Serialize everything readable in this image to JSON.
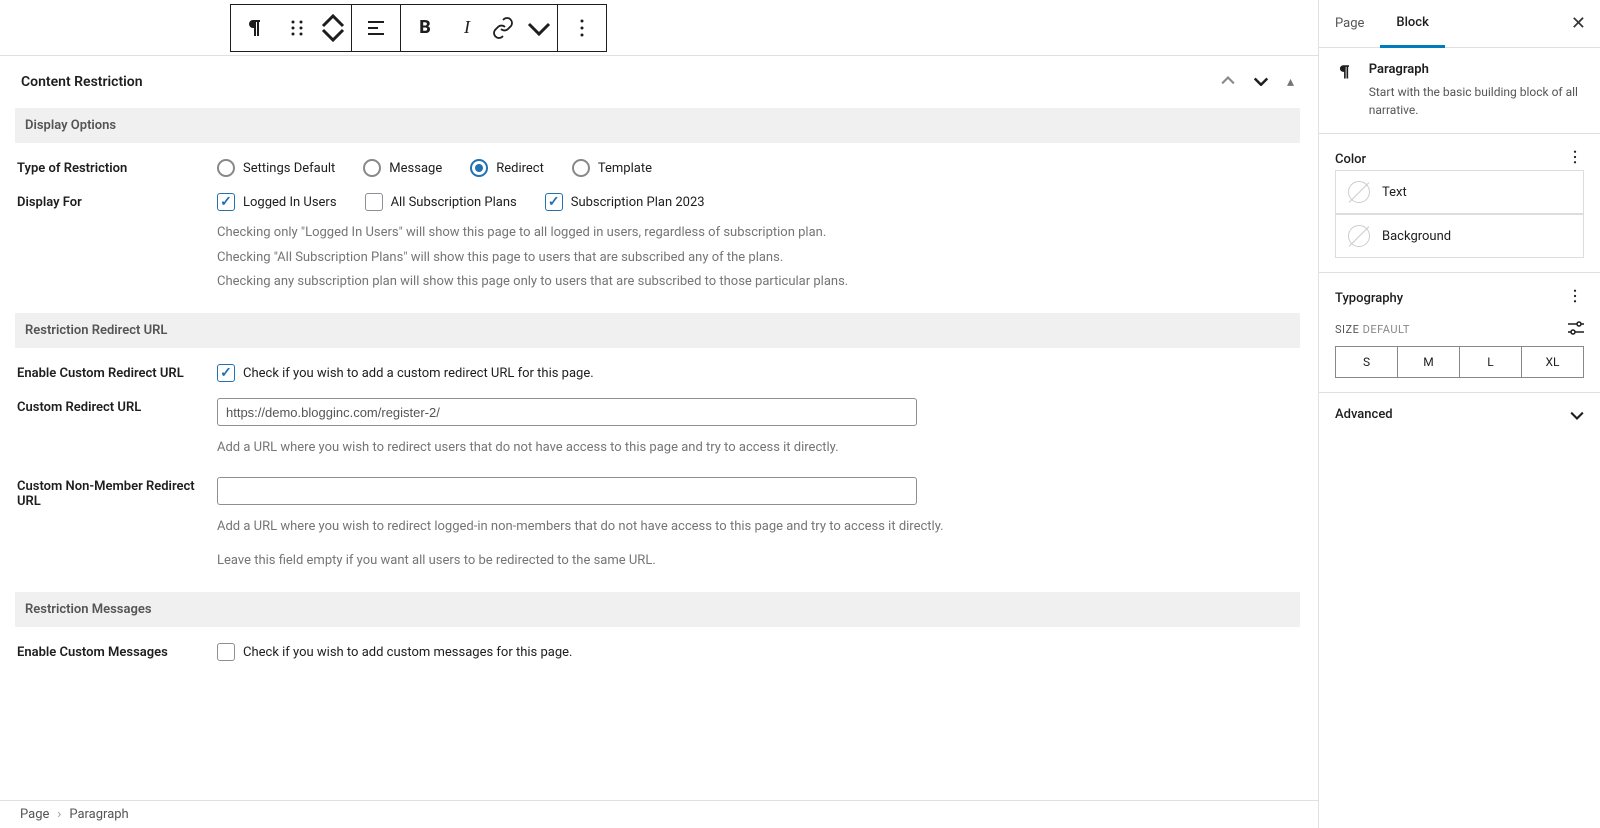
{
  "toolbar": {
    "paragraph_icon": "paragraph",
    "drag_icon": "drag",
    "align_icon": "align",
    "bold": "B",
    "italic": "I",
    "link_icon": "link"
  },
  "panel": {
    "title": "Content Restriction"
  },
  "sections": {
    "display_options": "Display Options",
    "restriction_redirect": "Restriction Redirect URL",
    "restriction_messages": "Restriction Messages"
  },
  "labels": {
    "type_of_restriction": "Type of Restriction",
    "display_for": "Display For",
    "enable_custom_redirect": "Enable Custom Redirect URL",
    "custom_redirect_url": "Custom Redirect URL",
    "custom_non_member_redirect": "Custom Non-Member Redirect URL",
    "enable_custom_messages": "Enable Custom Messages"
  },
  "options": {
    "restriction_type": [
      "Settings Default",
      "Message",
      "Redirect",
      "Template"
    ],
    "restriction_type_selected": 2,
    "display_for": [
      {
        "label": "Logged In Users",
        "checked": true
      },
      {
        "label": "All Subscription Plans",
        "checked": false
      },
      {
        "label": "Subscription Plan 2023",
        "checked": true
      }
    ]
  },
  "help": {
    "display_for_1": "Checking only \"Logged In Users\" will show this page to all logged in users, regardless of subscription plan.",
    "display_for_2": "Checking \"All Subscription Plans\" will show this page to users that are subscribed any of the plans.",
    "display_for_3": "Checking any subscription plan will show this page only to users that are subscribed to those particular plans.",
    "enable_redirect": "Check if you wish to add a custom redirect URL for this page.",
    "redirect_url_help": "Add a URL where you wish to redirect users that do not have access to this page and try to access it directly.",
    "non_member_help_1": "Add a URL where you wish to redirect logged-in non-members that do not have access to this page and try to access it directly.",
    "non_member_help_2": "Leave this field empty if you want all users to be redirected to the same URL.",
    "enable_messages": "Check if you wish to add custom messages for this page."
  },
  "inputs": {
    "redirect_url_value": "https://demo.blogginc.com/register-2/",
    "non_member_value": ""
  },
  "checkboxes": {
    "enable_redirect_checked": true,
    "enable_messages_checked": false
  },
  "footer": {
    "page": "Page",
    "crumb": "Paragraph"
  },
  "sidebar": {
    "tabs": [
      "Page",
      "Block"
    ],
    "active_tab": 1,
    "block": {
      "name": "Paragraph",
      "desc": "Start with the basic building block of all narrative."
    },
    "color": {
      "title": "Color",
      "text": "Text",
      "background": "Background"
    },
    "typography": {
      "title": "Typography",
      "size_label": "SIZE",
      "size_default": "DEFAULT",
      "sizes": [
        "S",
        "M",
        "L",
        "XL"
      ]
    },
    "advanced": "Advanced"
  }
}
